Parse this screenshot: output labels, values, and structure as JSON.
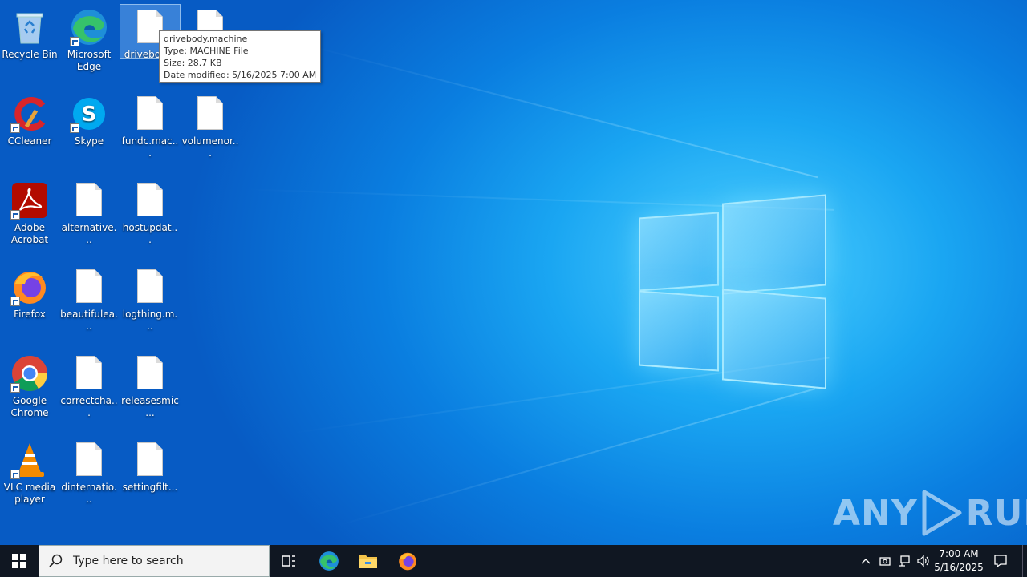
{
  "desktop": {
    "icons": [
      {
        "label": "Recycle Bin",
        "icon": "recycle-bin-icon"
      },
      {
        "label": "Microsoft Edge",
        "icon": "edge-icon"
      },
      {
        "label": "drivebod...",
        "icon": "file-icon"
      },
      {
        "label": "",
        "icon": "file-icon"
      },
      {
        "label": "CCleaner",
        "icon": "ccleaner-icon"
      },
      {
        "label": "Skype",
        "icon": "skype-icon"
      },
      {
        "label": "fundc.mac...",
        "icon": "file-icon"
      },
      {
        "label": "volumenor...",
        "icon": "file-icon"
      },
      {
        "label": "Adobe Acrobat",
        "icon": "acrobat-icon"
      },
      {
        "label": "alternative...",
        "icon": "file-icon"
      },
      {
        "label": "hostupdat...",
        "icon": "file-icon"
      },
      {
        "label": "Firefox",
        "icon": "firefox-icon"
      },
      {
        "label": "beautifulea...",
        "icon": "file-icon"
      },
      {
        "label": "logthing.m...",
        "icon": "file-icon"
      },
      {
        "label": "Google Chrome",
        "icon": "chrome-icon"
      },
      {
        "label": "correctcha...",
        "icon": "file-icon"
      },
      {
        "label": "releasesmic...",
        "icon": "file-icon"
      },
      {
        "label": "VLC media player",
        "icon": "vlc-icon"
      },
      {
        "label": "dinternatio...",
        "icon": "file-icon"
      },
      {
        "label": "settingfilt...",
        "icon": "file-icon"
      }
    ]
  },
  "tooltip": {
    "name": "drivebody.machine",
    "type": "Type: MACHINE File",
    "size": "Size: 28.7 KB",
    "modified": "Date modified: 5/16/2025 7:00 AM"
  },
  "watermark": {
    "left": "ANY",
    "right": "RUN"
  },
  "taskbar": {
    "search_placeholder": "Type here to search",
    "clock_time": "7:00 AM",
    "clock_date": "5/16/2025",
    "pinned": [
      "task-view-icon",
      "edge-icon",
      "file-explorer-icon",
      "firefox-icon"
    ]
  },
  "colors": {
    "taskbar": "#101722",
    "wallpaper_accent": "#0a7ee0"
  }
}
